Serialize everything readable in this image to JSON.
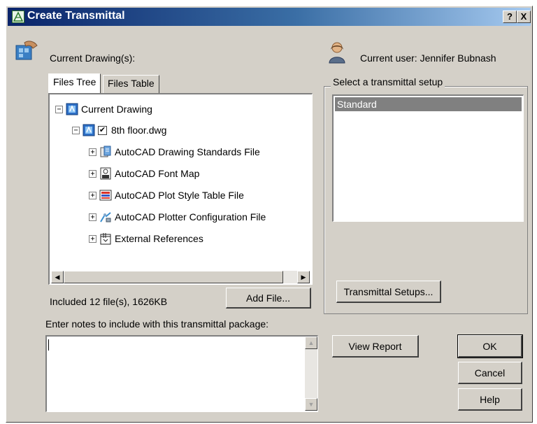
{
  "window": {
    "title": "Create Transmittal",
    "help_button": "?",
    "close_button": "X"
  },
  "left": {
    "current_drawings_label": "Current Drawing(s):",
    "tabs": [
      {
        "label": "Files Tree",
        "active": true
      },
      {
        "label": "Files Table",
        "active": false
      }
    ],
    "tree": {
      "root": {
        "label": "Current Drawing",
        "expander": "−"
      },
      "drawing": {
        "label": "8th floor.dwg",
        "checked": true,
        "expander": "−",
        "check_mark": "✔"
      },
      "children": [
        {
          "label": "AutoCAD Drawing Standards File",
          "icon": "standards-file-icon",
          "expander": "+"
        },
        {
          "label": "AutoCAD Font Map",
          "icon": "font-map-icon",
          "expander": "+"
        },
        {
          "label": "AutoCAD Plot Style Table File",
          "icon": "plot-style-icon",
          "expander": "+"
        },
        {
          "label": "AutoCAD Plotter Configuration File",
          "icon": "plotter-config-icon",
          "expander": "+"
        },
        {
          "label": "External References",
          "icon": "external-references-icon",
          "expander": "+"
        }
      ]
    },
    "included_summary": "Included 12 file(s), 1626KB",
    "add_file_button": "Add File..."
  },
  "right": {
    "current_user_label": "Current user: Jennifer Bubnash",
    "setup_group_label": "Select a transmittal setup",
    "setups": [
      "Standard"
    ],
    "selected_setup": "Standard",
    "transmittal_setups_button": "Transmittal Setups..."
  },
  "notes": {
    "label": "Enter notes to include with this transmittal package:",
    "value": ""
  },
  "buttons": {
    "view_report": "View Report",
    "ok": "OK",
    "cancel": "Cancel",
    "help": "Help"
  },
  "colors": {
    "titlebar_start": "#0a246a",
    "titlebar_end": "#a6caf0",
    "dialog_face": "#d4d0c8",
    "selection": "#808080"
  }
}
